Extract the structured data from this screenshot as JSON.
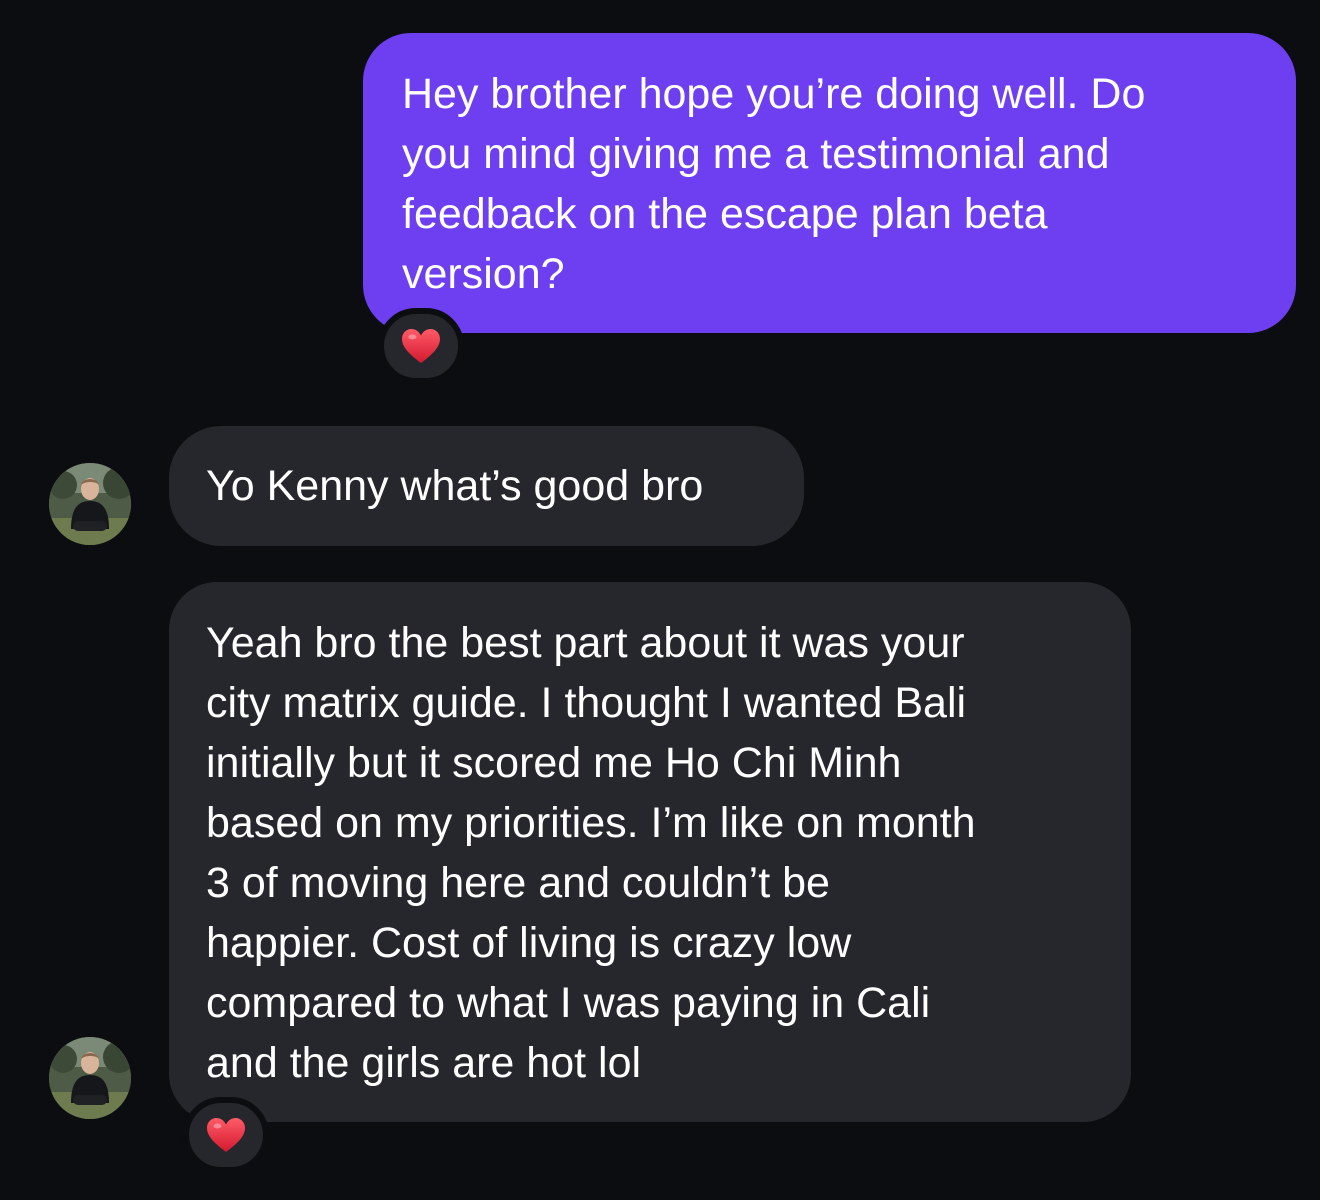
{
  "conversation": {
    "messages": [
      {
        "sender": "me",
        "text": "Hey brother hope you’re doing well. Do\nyou mind giving me a testimonial and\nfeedback on the escape plan beta\nversion?",
        "reaction": "❤️"
      },
      {
        "sender": "contact",
        "text": "Yo Kenny what’s good bro",
        "reaction": ""
      },
      {
        "sender": "contact",
        "text": "Yeah bro the best part about it was your\ncity matrix guide. I thought I wanted Bali\ninitially but it scored me Ho Chi Minh\nbased on my priorities. I’m like on month\n3 of moving here and couldn’t be\nhappier. Cost of living is crazy low\ncompared to what I was paying in Cali\nand the girls are hot lol",
        "reaction": "❤️"
      }
    ]
  },
  "colors": {
    "background": "#0c0d10",
    "outgoing_bubble": "#6e3ff0",
    "incoming_bubble": "#26272c",
    "text": "#ffffff",
    "heart": "#e0243a"
  },
  "icons": {
    "reaction": "heart-icon",
    "avatar": "contact-avatar"
  }
}
